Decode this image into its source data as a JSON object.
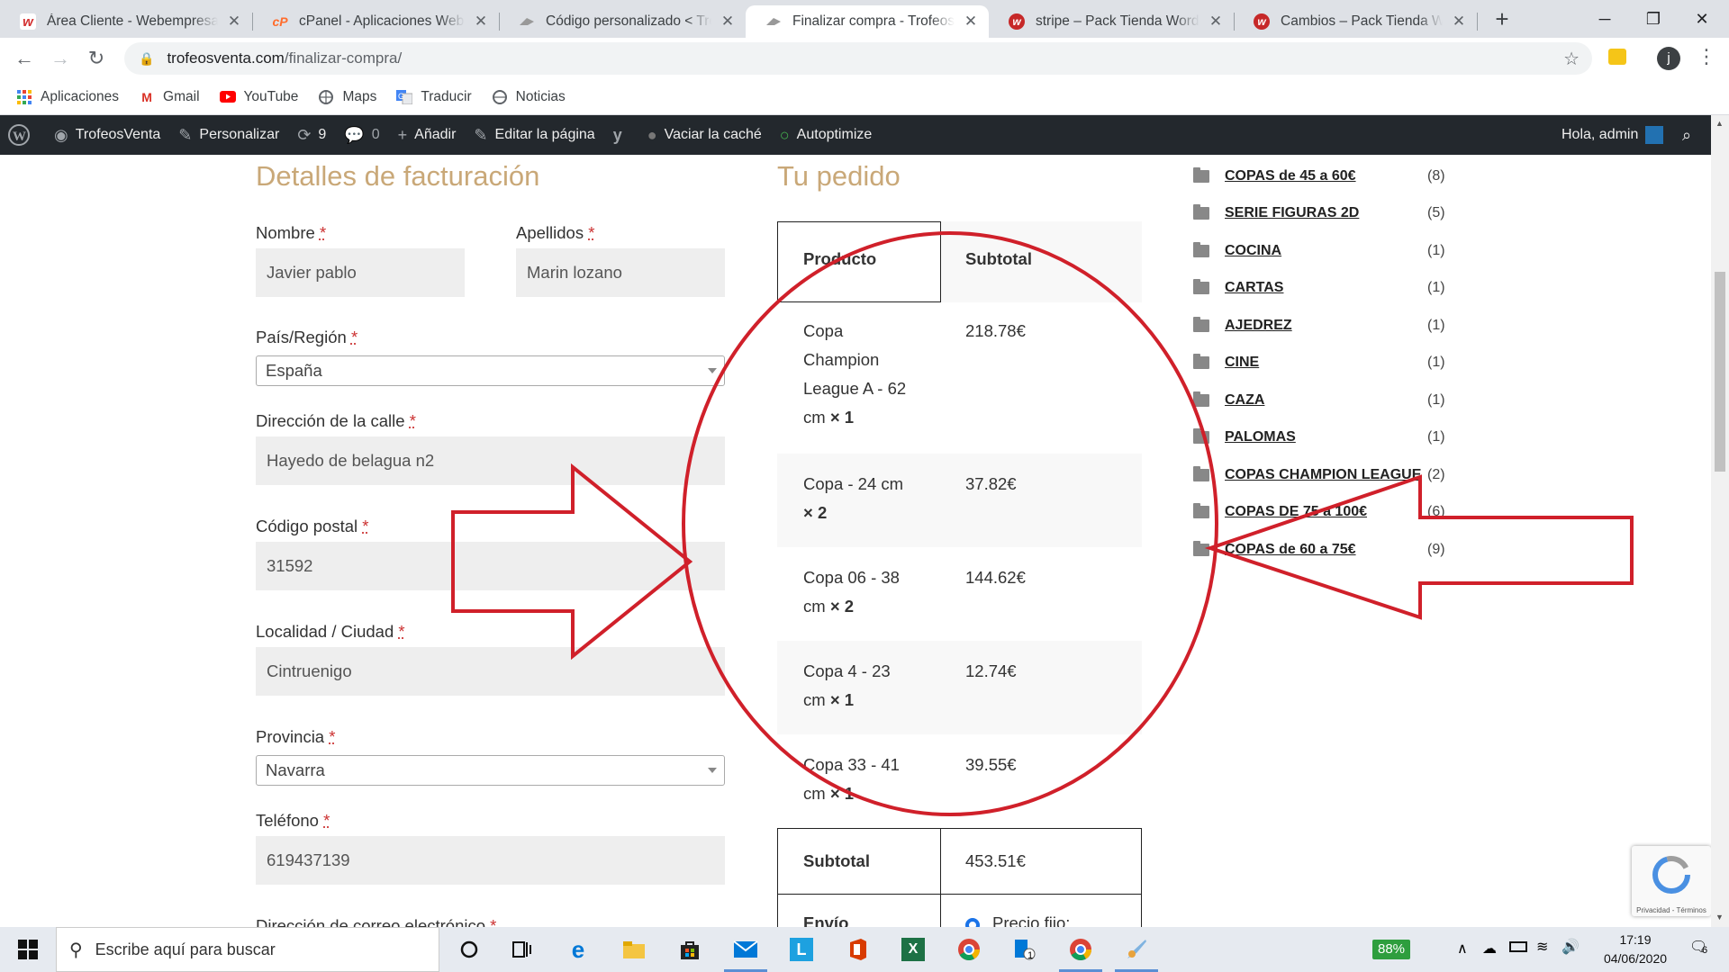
{
  "browser": {
    "tabs": [
      {
        "title": "Área Cliente - Webempresa E",
        "icon": "webempresa-icon",
        "color": "#d32f2f"
      },
      {
        "title": "cPanel - Aplicaciones Webem",
        "icon": "cpanel-icon",
        "color": "#ff6c2c"
      },
      {
        "title": "Código personalizado < Trof",
        "icon": "trofeos-icon",
        "color": "#999999"
      },
      {
        "title": "Finalizar compra - TrofeosVe",
        "icon": "trofeos-icon",
        "color": "#999999",
        "active": true
      },
      {
        "title": "stripe – Pack Tienda WordPre",
        "icon": "webempresa-icon",
        "color": "#c62828"
      },
      {
        "title": "Cambios – Pack Tienda Word",
        "icon": "webempresa-icon",
        "color": "#c62828"
      }
    ],
    "new_tab": "+",
    "url_host": "trofeosventa.com",
    "url_path": "/finalizar-compra/",
    "profile_initial": "j",
    "bookmarks": [
      {
        "label": "Aplicaciones",
        "icon": "apps-grid-icon"
      },
      {
        "label": "Gmail",
        "icon": "gmail-icon"
      },
      {
        "label": "YouTube",
        "icon": "youtube-icon"
      },
      {
        "label": "Maps",
        "icon": "maps-icon"
      },
      {
        "label": "Traducir",
        "icon": "translate-icon"
      },
      {
        "label": "Noticias",
        "icon": "news-icon"
      }
    ]
  },
  "adminbar": {
    "site": "TrofeosVenta",
    "customize": "Personalizar",
    "updates": "9",
    "comments": "0",
    "add": "Añadir",
    "edit": "Editar la página",
    "cache": "Vaciar la caché",
    "autoptimize": "Autoptimize",
    "greeting": "Hola, admin"
  },
  "billing": {
    "heading": "Detalles de facturación",
    "req": "*",
    "nombre_label": "Nombre",
    "nombre": "Javier pablo",
    "apellidos_label": "Apellidos",
    "apellidos": "Marin lozano",
    "pais_label": "País/Región",
    "pais": "España",
    "calle_label": "Dirección de la calle",
    "calle": "Hayedo de belagua n2",
    "cp_label": "Código postal",
    "cp": "31592",
    "ciudad_label": "Localidad / Ciudad",
    "ciudad": "Cintruenigo",
    "provincia_label": "Provincia",
    "provincia": "Navarra",
    "telefono_label": "Teléfono",
    "telefono": "619437139",
    "email_label": "Dirección de correo electrónico"
  },
  "order": {
    "heading": "Tu pedido",
    "col_product": "Producto",
    "col_subtotal": "Subtotal",
    "items": [
      {
        "name_lines": [
          "Copa",
          "Champion",
          "League A - 62",
          "cm"
        ],
        "qty": "× 1",
        "subtotal": "218.78€"
      },
      {
        "name_lines": [
          "Copa - 24 cm"
        ],
        "qty": "× 2",
        "subtotal": "37.82€"
      },
      {
        "name_lines": [
          "Copa 06 - 38",
          "cm"
        ],
        "qty": "× 2",
        "subtotal": "144.62€"
      },
      {
        "name_lines": [
          "Copa 4 - 23",
          "cm"
        ],
        "qty": "× 1",
        "subtotal": "12.74€"
      },
      {
        "name_lines": [
          "Copa 33 - 41",
          "cm"
        ],
        "qty": "× 1",
        "subtotal": "39.55€"
      }
    ],
    "subtotal_label": "Subtotal",
    "subtotal_value": "453.51€",
    "envio_label": "Envío",
    "envio_option": "Precio fijo:"
  },
  "categories": [
    {
      "name": "COPAS de 45 a 60€",
      "count": "(8)"
    },
    {
      "name": "SERIE FIGURAS 2D",
      "count": "(5)"
    },
    {
      "name": "COCINA",
      "count": "(1)"
    },
    {
      "name": "CARTAS",
      "count": "(1)"
    },
    {
      "name": "AJEDREZ",
      "count": "(1)"
    },
    {
      "name": "CINE",
      "count": "(1)"
    },
    {
      "name": "CAZA",
      "count": "(1)"
    },
    {
      "name": "PALOMAS",
      "count": "(1)"
    },
    {
      "name": "COPAS CHAMPION LEAGUE",
      "count": "(2)"
    },
    {
      "name": "COPAS DE 75 a 100€",
      "count": "(6)"
    },
    {
      "name": "COPAS de 60 a 75€",
      "count": "(9)"
    }
  ],
  "recaptcha_text": "Privacidad - Términos",
  "taskbar": {
    "search_placeholder": "Escribe aquí para buscar",
    "battery": "88%",
    "time": "17:19",
    "date": "04/06/2020",
    "notifications": "6",
    "badge_count": "1"
  },
  "annotation_color": "#d0202a"
}
